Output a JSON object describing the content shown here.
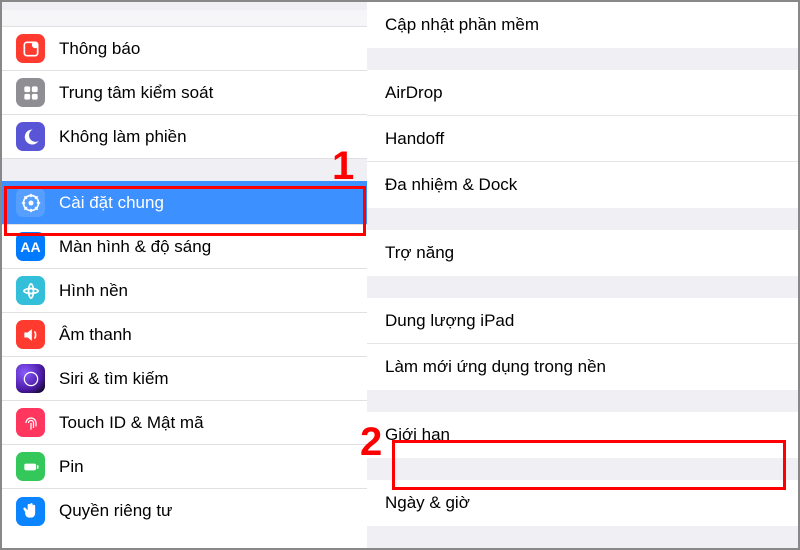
{
  "annotations": {
    "one": "1",
    "two": "2"
  },
  "sidebar": {
    "items": [
      {
        "label": "Thông báo"
      },
      {
        "label": "Trung tâm kiểm soát"
      },
      {
        "label": "Không làm phiền"
      },
      {
        "label": "Cài đặt chung"
      },
      {
        "label": "Màn hình & độ sáng"
      },
      {
        "label": "Hình nền"
      },
      {
        "label": "Âm thanh"
      },
      {
        "label": "Siri & tìm kiếm"
      },
      {
        "label": "Touch ID & Mật mã"
      },
      {
        "label": "Pin"
      },
      {
        "label": "Quyền riêng tư"
      }
    ]
  },
  "main": {
    "software_update": "Cập nhật phần mềm",
    "airdrop": "AirDrop",
    "handoff": "Handoff",
    "multitask": "Đa nhiệm & Dock",
    "accessibility": "Trợ năng",
    "storage": "Dung lượng iPad",
    "background_refresh": "Làm mới ứng dụng trong nền",
    "restrictions": "Giới hạn",
    "datetime": "Ngày & giờ"
  }
}
